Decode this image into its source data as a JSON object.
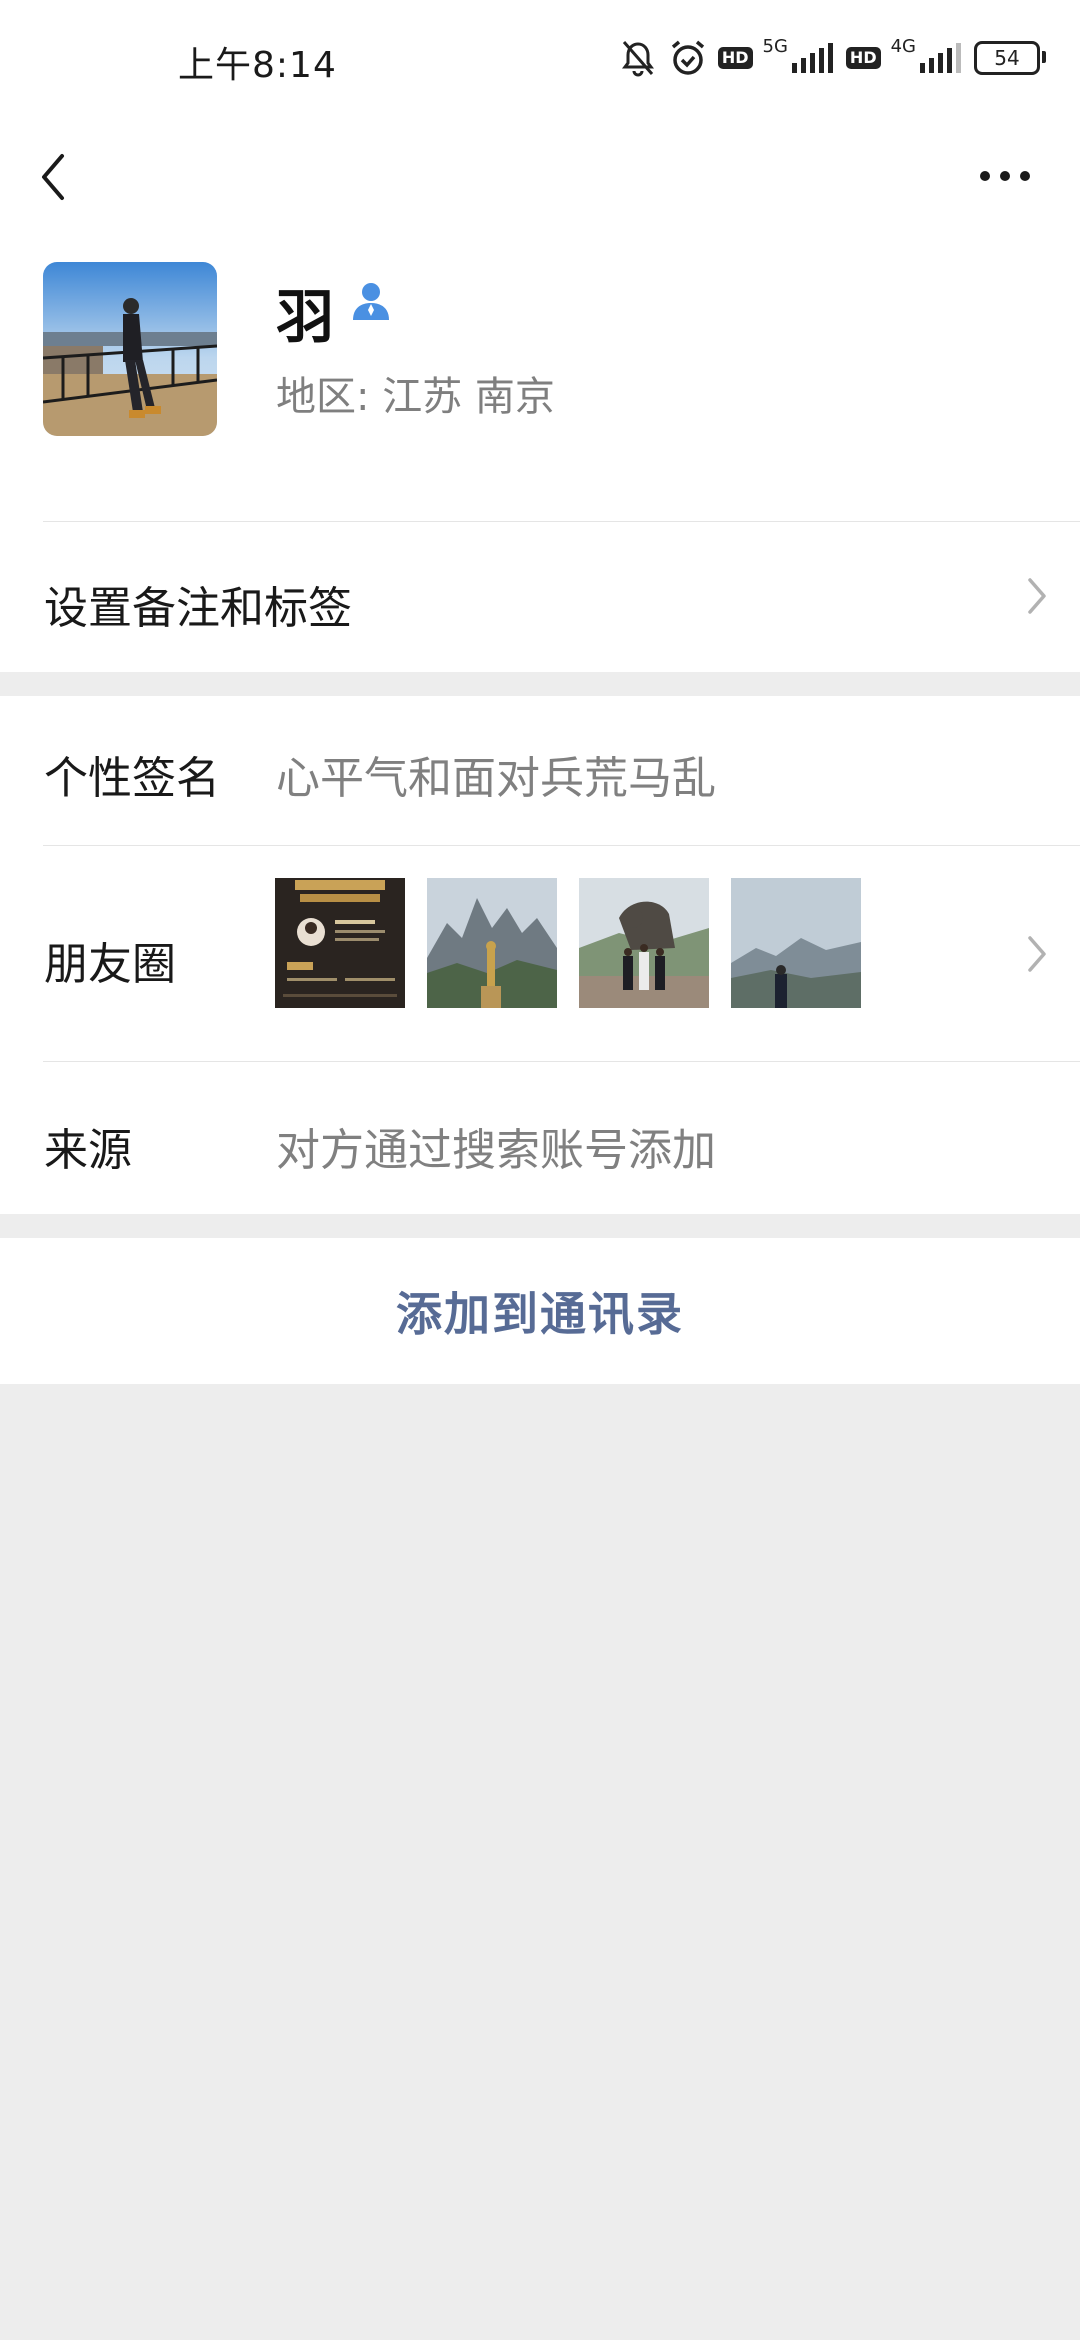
{
  "status_bar": {
    "time": "上午8:14",
    "hd1": "HD",
    "net1": "5G",
    "hd2": "HD",
    "net2": "4G",
    "battery": "54"
  },
  "nav": {
    "back_icon": "chevron-left-icon",
    "more_icon": "more-dots-icon"
  },
  "profile": {
    "name": "羽",
    "region": "地区:  江苏  南京",
    "badge_color": "#4a90e2"
  },
  "remark_row": {
    "label": "设置备注和标签"
  },
  "signature_row": {
    "label": "个性签名",
    "value": "心平气和面对兵荒马乱"
  },
  "moments_row": {
    "label": "朋友圈",
    "thumbnails": [
      "poster",
      "mountain-statue",
      "lion-statue-group",
      "mountain-person"
    ]
  },
  "source_row": {
    "label": "来源",
    "value": "对方通过搜索账号添加"
  },
  "add_button": {
    "label": "添加到通讯录",
    "color": "#576b95"
  }
}
